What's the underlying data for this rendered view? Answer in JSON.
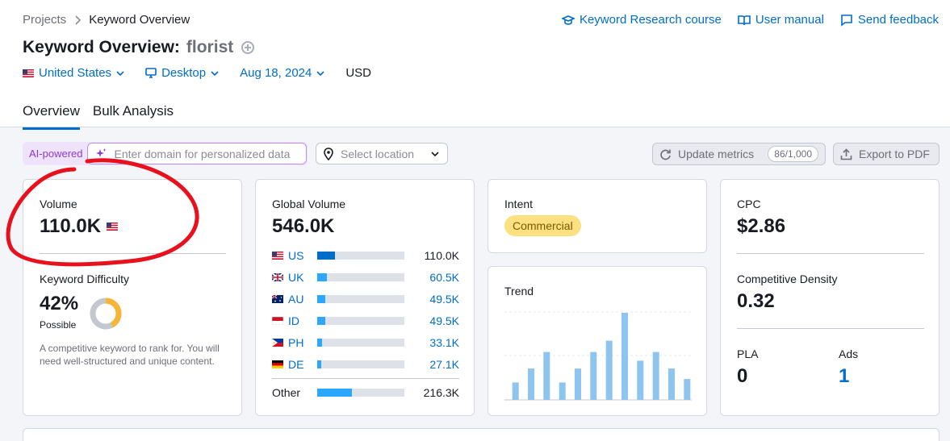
{
  "breadcrumb": {
    "parent": "Projects",
    "current": "Keyword Overview"
  },
  "top_links": [
    {
      "label": "Keyword Research course",
      "icon": "graduation-cap-icon"
    },
    {
      "label": "User manual",
      "icon": "book-icon"
    },
    {
      "label": "Send feedback",
      "icon": "chat-icon"
    }
  ],
  "header": {
    "title": "Keyword Overview:",
    "keyword": "florist"
  },
  "filters": {
    "country": "United States",
    "device": "Desktop",
    "date": "Aug 18, 2024",
    "currency": "USD"
  },
  "tabs": [
    {
      "label": "Overview",
      "active": true
    },
    {
      "label": "Bulk Analysis",
      "active": false
    }
  ],
  "toolbar": {
    "ai_label": "AI-powered",
    "ai_placeholder": "Enter domain for personalized data",
    "location_placeholder": "Select location",
    "update_label": "Update metrics",
    "update_count": "86/1,000",
    "export_label": "Export to PDF"
  },
  "volume": {
    "label": "Volume",
    "value": "110.0K"
  },
  "difficulty": {
    "label": "Keyword Difficulty",
    "value": "42%",
    "level": "Possible",
    "percent": 42,
    "description": "A competitive keyword to rank for. You will need well-structured and unique content."
  },
  "global_volume": {
    "label": "Global Volume",
    "value": "546.0K",
    "rows": [
      {
        "code": "US",
        "value": "110.0K",
        "share": 0.2
      },
      {
        "code": "UK",
        "value": "60.5K",
        "share": 0.11
      },
      {
        "code": "AU",
        "value": "49.5K",
        "share": 0.09
      },
      {
        "code": "ID",
        "value": "49.5K",
        "share": 0.09
      },
      {
        "code": "PH",
        "value": "33.1K",
        "share": 0.06
      },
      {
        "code": "DE",
        "value": "27.1K",
        "share": 0.05
      }
    ],
    "other": {
      "label": "Other",
      "value": "216.3K",
      "share": 0.4
    }
  },
  "intent": {
    "label": "Intent",
    "value": "Commercial"
  },
  "trend": {
    "label": "Trend",
    "values": [
      20,
      36,
      55,
      20,
      36,
      55,
      68,
      100,
      45,
      55,
      36,
      24
    ]
  },
  "cpc": {
    "label": "CPC",
    "value": "$2.86"
  },
  "competitive_density": {
    "label": "Competitive Density",
    "value": "0.32"
  },
  "pla": {
    "label": "PLA",
    "value": "0"
  },
  "ads": {
    "label": "Ads",
    "value": "1"
  },
  "colors": {
    "accent": "#006dca",
    "bar": "#2ba7ff",
    "trend_bar": "#8ec5f0",
    "annotation": "#e8101c"
  }
}
